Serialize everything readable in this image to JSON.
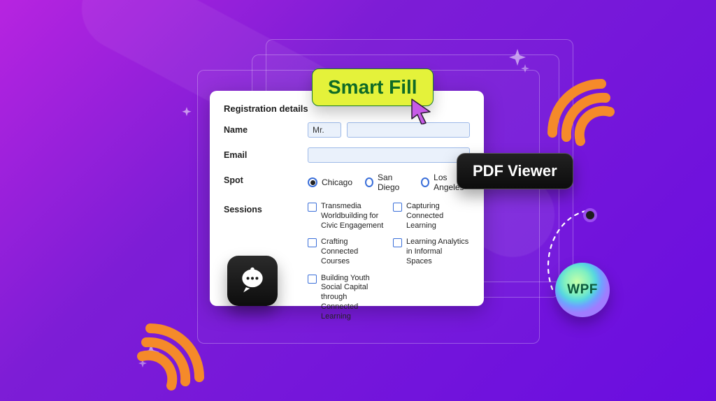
{
  "badges": {
    "smart_fill": "Smart Fill",
    "pdf_viewer": "PDF Viewer",
    "wpf": "WPF"
  },
  "form": {
    "title": "Registration details",
    "labels": {
      "name": "Name",
      "email": "Email",
      "spot": "Spot",
      "sessions": "Sessions"
    },
    "name_prefix": "Mr.",
    "name_value": "",
    "email_value": "",
    "spots": [
      {
        "label": "Chicago",
        "selected": true
      },
      {
        "label": "San Diego",
        "selected": false
      },
      {
        "label": "Los Angeles",
        "selected": false
      }
    ],
    "sessions": {
      "col1": [
        "Transmedia Worldbuilding for Civic Engagement",
        "Crafting Connected Courses",
        "Building Youth Social Capital through Connected Learning"
      ],
      "col2": [
        "Capturing Connected Learning",
        "Learning Analytics in Informal Spaces"
      ]
    }
  }
}
